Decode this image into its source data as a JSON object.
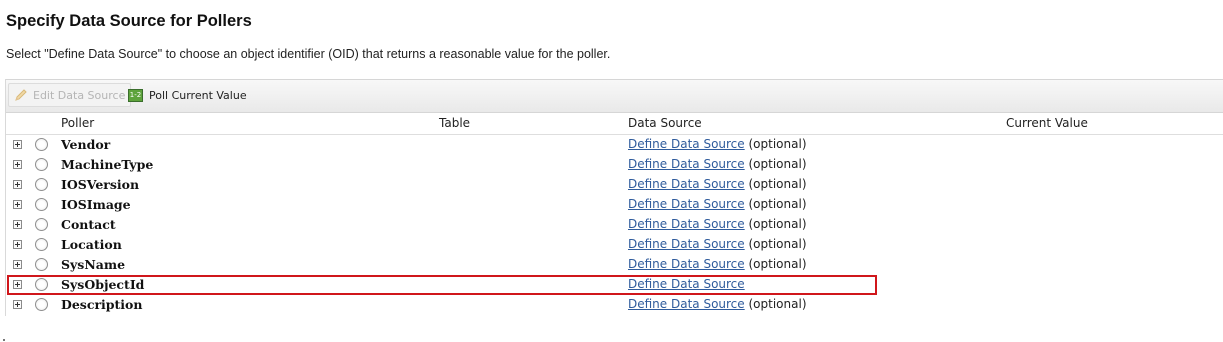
{
  "page": {
    "title": "Specify Data Source for Pollers",
    "description": "Select \"Define Data Source\" to choose an object identifier (OID) that returns a reasonable value for the poller."
  },
  "toolbar": {
    "edit_label": "Edit Data Source",
    "edit_icon": "pencil-icon",
    "poll_label": "Poll Current Value",
    "poll_icon": "poll-value-icon",
    "poll_icon_text": "1-2"
  },
  "columns": {
    "poller": "Poller",
    "table": "Table",
    "data_source": "Data Source",
    "current_value": "Current Value"
  },
  "rows": [
    {
      "name": "Vendor",
      "link": "Define Data Source",
      "suffix": "(optional)"
    },
    {
      "name": "MachineType",
      "link": "Define Data Source",
      "suffix": "(optional)"
    },
    {
      "name": "IOSVersion",
      "link": "Define Data Source",
      "suffix": "(optional)"
    },
    {
      "name": "IOSImage",
      "link": "Define Data Source",
      "suffix": "(optional)"
    },
    {
      "name": "Contact",
      "link": "Define Data Source",
      "suffix": "(optional)"
    },
    {
      "name": "Location",
      "link": "Define Data Source",
      "suffix": "(optional)"
    },
    {
      "name": "SysName",
      "link": "Define Data Source",
      "suffix": "(optional)"
    },
    {
      "name": "SysObjectId",
      "link": "Define Data Source",
      "suffix": ""
    },
    {
      "name": "Description",
      "link": "Define Data Source",
      "suffix": "(optional)"
    }
  ],
  "colors": {
    "highlight": "#d0161b",
    "link": "#2f5b9c"
  }
}
